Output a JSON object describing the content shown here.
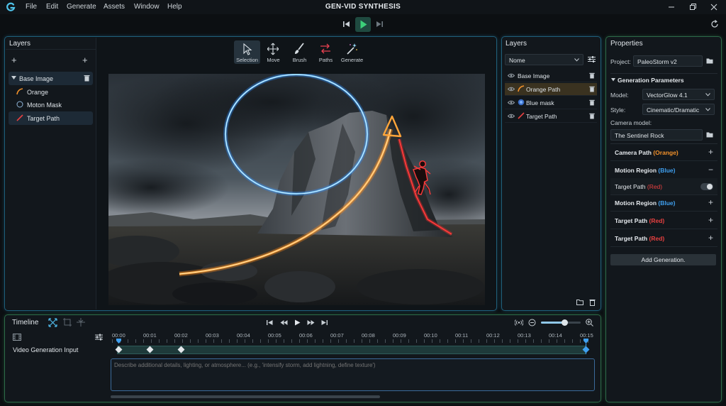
{
  "app": {
    "title": "GEN-VID SYNTHESIS",
    "menu": [
      "File",
      "Edit",
      "Generate",
      "Assets",
      "Window",
      "Help"
    ]
  },
  "layers_left": {
    "title": "Layers",
    "items": [
      {
        "label": "Base Image",
        "icon": "triangle-down-icon"
      },
      {
        "label": "Orange",
        "icon": "orange-path-icon"
      },
      {
        "label": "Moton Mask",
        "icon": "circle-mask-icon"
      },
      {
        "label": "Target Path",
        "icon": "red-path-icon"
      }
    ]
  },
  "toolbar": {
    "tools": [
      {
        "label": "Selection",
        "icon": "cursor-icon"
      },
      {
        "label": "Move",
        "icon": "move-icon"
      },
      {
        "label": "Brush",
        "icon": "brush-icon"
      },
      {
        "label": "Paths",
        "icon": "paths-icon"
      },
      {
        "label": "Generate",
        "icon": "magic-wand-icon"
      }
    ],
    "selected": "Selection"
  },
  "layers_right": {
    "title": "Layers",
    "blend_mode": "Nome",
    "items": [
      {
        "label": "Base Image"
      },
      {
        "label": "Orange Path"
      },
      {
        "label": "Blue mask"
      },
      {
        "label": "Target Path"
      }
    ]
  },
  "properties": {
    "title": "Properties",
    "project_label": "Project:",
    "project_value": "PaleoStorm v2",
    "section_title": "Generation Parameters",
    "model_label": "Model:",
    "model_value": "VectorGlow 4.1",
    "style_label": "Style:",
    "style_value": "Cinematic/Dramatic",
    "camera_label": "Camera model:",
    "camera_value": "The Sentinel Rock",
    "rows": [
      {
        "name": "Camera Path",
        "tag": "(Orange)",
        "tag_color": "#f0902a",
        "action": "+"
      },
      {
        "name": "Motion Region",
        "tag": "(Blue)",
        "tag_color": "#3fa0f0",
        "action": "−"
      },
      {
        "name": "Target Path",
        "tag": "(Red)",
        "tag_color": "#e84040",
        "action": "toggle"
      },
      {
        "name": "Motion Region",
        "tag": "(Blue)",
        "tag_color": "#3fa0f0",
        "action": "+"
      },
      {
        "name": "Target Path",
        "tag": "(Red)",
        "tag_color": "#e84040",
        "action": "+"
      },
      {
        "name": "Target Path",
        "tag": "(Red)",
        "tag_color": "#e84040",
        "action": "+"
      }
    ],
    "add_button": "Add Generation."
  },
  "timeline": {
    "title": "Timeline",
    "ticks": [
      "00:00",
      "00:01",
      "00:02",
      "00:03",
      "00:04",
      "00:05",
      "00:06",
      "00:07",
      "00:08",
      "00:09",
      "00:10",
      "00:11",
      "00:12",
      "00:13",
      "00:14",
      "00:15"
    ],
    "track_label": "Video Generation Input",
    "prompt_placeholder": "Describe additional details, lighting, or atmosphere... (e.g., 'intensify storm, add lightning, define texture')",
    "zoom_level": 0.6
  },
  "colors": {
    "accent_blue": "#3fa0f0",
    "accent_orange": "#f0902a",
    "accent_red": "#e84040",
    "play_green": "#3cd07a"
  }
}
